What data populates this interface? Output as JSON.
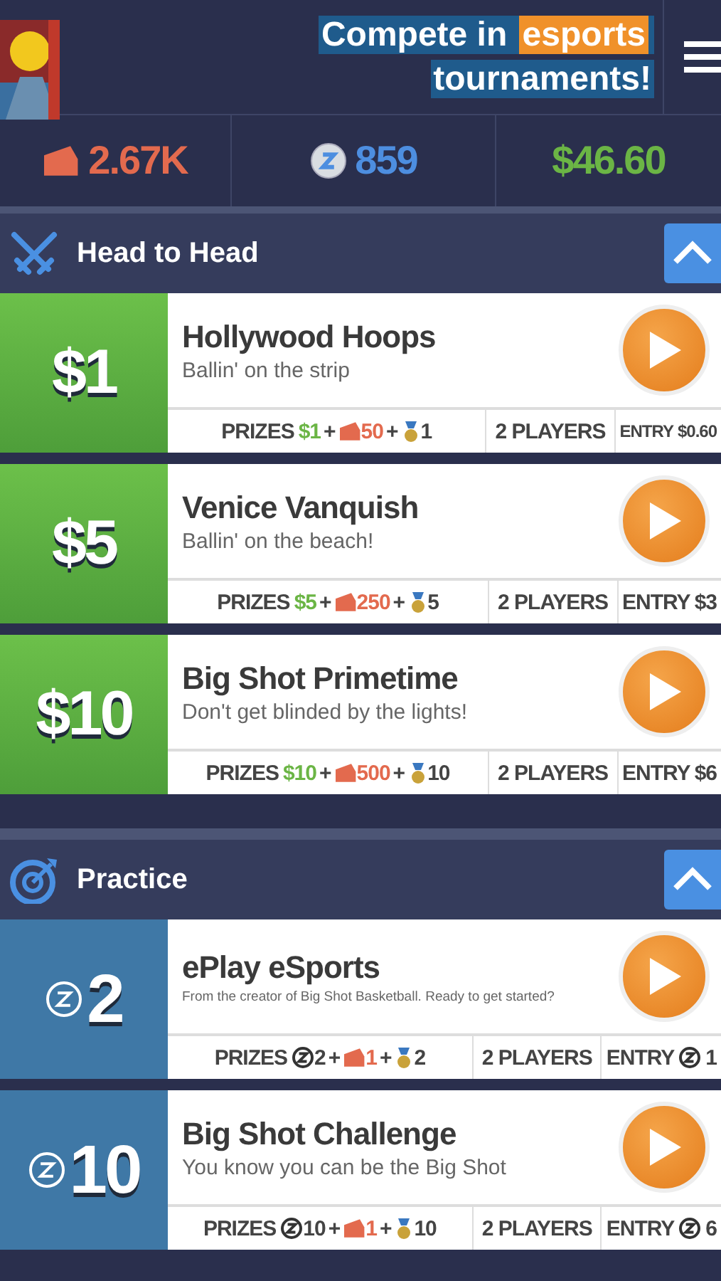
{
  "header": {
    "title": [
      {
        "text": "Compete in ",
        "highlight": false
      },
      {
        "text": "esports",
        "highlight": true
      },
      {
        "text": " tournaments!",
        "highlight": false
      }
    ]
  },
  "balances": [
    {
      "kind": "tickets",
      "amount": "2.67K"
    },
    {
      "kind": "zcoin",
      "amount": "859"
    },
    {
      "kind": "cash",
      "amount": "$46.60"
    }
  ],
  "sections": [
    {
      "kind": "head_to_head",
      "title": "Head to Head",
      "expanded": true,
      "games": [
        {
          "price": {
            "kind": "cash",
            "amount": "$1"
          },
          "title": "Hollywood Hoops",
          "subtitle": "Ballin' on the strip",
          "prizes": {
            "label": "PRIZES",
            "items": [
              {
                "kind": "cash",
                "text": "$1"
              },
              {
                "kind": "plus",
                "text": "+"
              },
              {
                "kind": "tickets",
                "text": "50"
              },
              {
                "kind": "plus",
                "text": "+"
              },
              {
                "kind": "medal",
                "text": "1"
              }
            ]
          },
          "players": "2 PLAYERS",
          "entry": {
            "label": "ENTRY",
            "kind": "cash",
            "amount": "$0.60"
          }
        },
        {
          "price": {
            "kind": "cash",
            "amount": "$5"
          },
          "title": "Venice Vanquish",
          "subtitle": "Ballin' on the beach!",
          "prizes": {
            "label": "PRIZES",
            "items": [
              {
                "kind": "cash",
                "text": "$5"
              },
              {
                "kind": "plus",
                "text": "+"
              },
              {
                "kind": "tickets",
                "text": "250"
              },
              {
                "kind": "plus",
                "text": "+"
              },
              {
                "kind": "medal",
                "text": "5"
              }
            ]
          },
          "players": "2 PLAYERS",
          "entry": {
            "label": "ENTRY",
            "kind": "cash",
            "amount": "$3"
          }
        },
        {
          "price": {
            "kind": "cash",
            "amount": "$10"
          },
          "title": "Big Shot Primetime",
          "subtitle": "Don't get blinded by the lights!",
          "prizes": {
            "label": "PRIZES",
            "items": [
              {
                "kind": "cash",
                "text": "$10"
              },
              {
                "kind": "plus",
                "text": "+"
              },
              {
                "kind": "tickets",
                "text": "500"
              },
              {
                "kind": "plus",
                "text": "+"
              },
              {
                "kind": "medal",
                "text": "10"
              }
            ]
          },
          "players": "2 PLAYERS",
          "entry": {
            "label": "ENTRY",
            "kind": "cash",
            "amount": "$6"
          }
        }
      ]
    },
    {
      "kind": "practice",
      "title": "Practice",
      "expanded": true,
      "games": [
        {
          "price": {
            "kind": "zcoin",
            "amount": "2"
          },
          "title": "ePlay eSports",
          "subtitle": "From the creator of Big Shot Basketball. Ready to get started?",
          "prizes": {
            "label": "PRIZES",
            "items": [
              {
                "kind": "zcoin",
                "text": "2"
              },
              {
                "kind": "plus",
                "text": "+"
              },
              {
                "kind": "tickets",
                "text": "1"
              },
              {
                "kind": "plus",
                "text": "+"
              },
              {
                "kind": "medal",
                "text": "2"
              }
            ]
          },
          "players": "2 PLAYERS",
          "entry": {
            "label": "ENTRY",
            "kind": "zcoin",
            "amount": "1"
          }
        },
        {
          "price": {
            "kind": "zcoin",
            "amount": "10"
          },
          "title": "Big Shot Challenge",
          "subtitle": "You know you can be the Big Shot",
          "prizes": {
            "label": "PRIZES",
            "items": [
              {
                "kind": "zcoin",
                "text": "10"
              },
              {
                "kind": "plus",
                "text": "+"
              },
              {
                "kind": "tickets",
                "text": "1"
              },
              {
                "kind": "plus",
                "text": "+"
              },
              {
                "kind": "medal",
                "text": "10"
              }
            ]
          },
          "players": "2 PLAYERS",
          "entry": {
            "label": "ENTRY",
            "kind": "zcoin",
            "amount": "6"
          }
        }
      ]
    }
  ]
}
